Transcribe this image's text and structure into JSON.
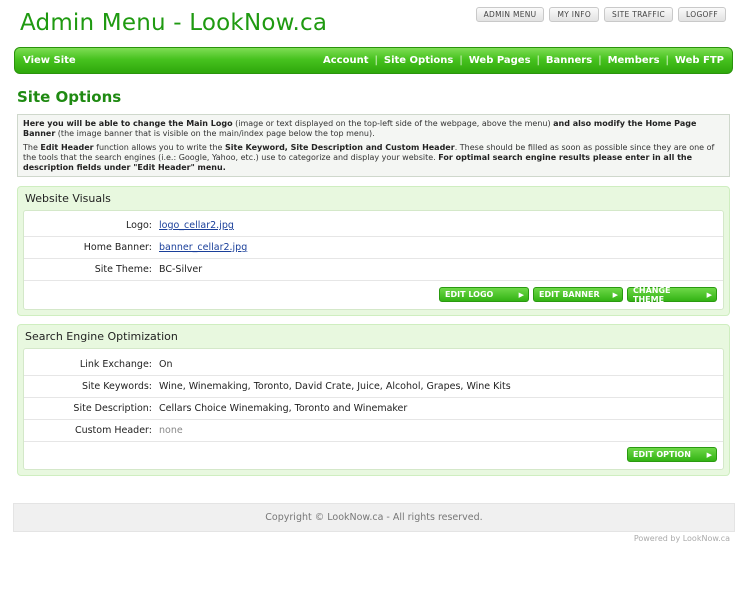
{
  "header": {
    "title": "Admin Menu - LookNow.ca",
    "top_links": [
      "ADMIN MENU",
      "MY INFO",
      "SITE TRAFFIC",
      "LOGOFF"
    ]
  },
  "nav": {
    "left": "View Site",
    "items": [
      "Account",
      "Site Options",
      "Web Pages",
      "Banners",
      "Members",
      "Web FTP"
    ],
    "separator": "|"
  },
  "page": {
    "title": "Site Options"
  },
  "info": {
    "p1_b1": "Here you will be able to change the Main Logo",
    "p1_t1": " (image or text displayed on the top-left side of the webpage, above the menu) ",
    "p1_b2": "and also modify the Home Page Banner",
    "p1_t2": " (the image banner that is visible on the main/index page below the top menu).",
    "p2_t1": "The ",
    "p2_b1": "Edit Header",
    "p2_t2": " function allows you to write the ",
    "p2_b2": "Site Keyword, Site Description and Custom Header",
    "p2_t3": ". These should be filled as soon as possible since they are one of the tools that the search engines (i.e.: Google, Yahoo, etc.) use to categorize and display your website. ",
    "p2_b3": "For optimal search engine results please enter in all the description fields under \"Edit Header\" menu."
  },
  "visuals": {
    "title": "Website Visuals",
    "rows": [
      {
        "label": "Logo:",
        "value": "logo_cellar2.jpg"
      },
      {
        "label": "Home Banner:",
        "value": "banner_cellar2.jpg"
      },
      {
        "label": "Site Theme:",
        "value": "BC-Silver"
      }
    ],
    "buttons": [
      "EDIT LOGO",
      "EDIT BANNER",
      "CHANGE THEME"
    ]
  },
  "seo": {
    "title": "Search Engine Optimization",
    "rows": [
      {
        "label": "Link Exchange:",
        "value": "On"
      },
      {
        "label": "Site Keywords:",
        "value": "Wine, Winemaking, Toronto, David Crate, Juice, Alcohol, Grapes, Wine Kits"
      },
      {
        "label": "Site Description:",
        "value": "Cellars Choice Winemaking, Toronto and Winemaker"
      },
      {
        "label": "Custom Header:",
        "value": "none"
      }
    ],
    "buttons": [
      "EDIT OPTION"
    ]
  },
  "footer": {
    "copyright": "Copyright © LookNow.ca - All rights reserved.",
    "powered": "Powered by LookNow.ca"
  },
  "colors": {
    "accent": "#1f9a11",
    "nav_green": "#47c21f",
    "panel_bg": "#e8f8df",
    "link": "#1a3f9a"
  },
  "icons": {
    "button_arrow": "play-arrow-icon"
  }
}
